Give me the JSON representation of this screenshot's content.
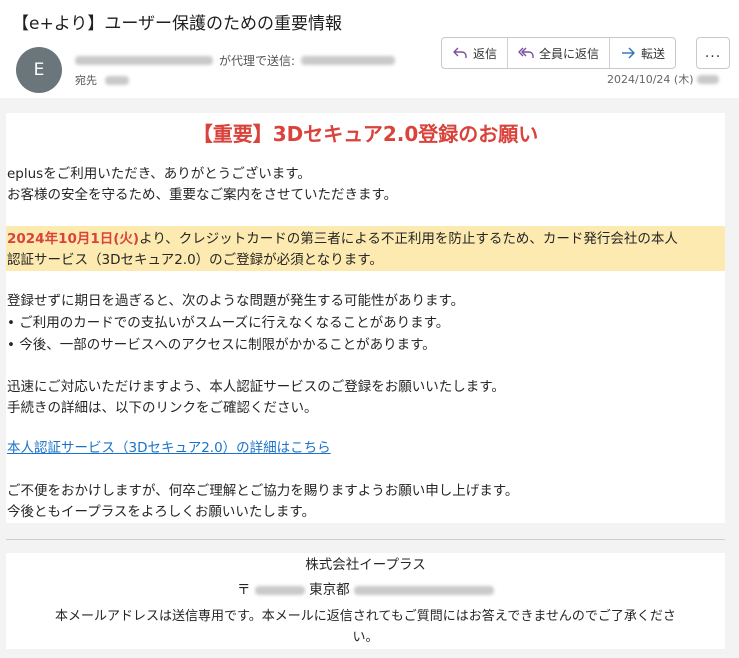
{
  "email": {
    "subject": "【e+より】ユーザー保護のための重要情報",
    "avatar_letter": "E",
    "sender_via": "が代理で送信:",
    "to_label": "宛先",
    "date": "2024/10/24 (木)"
  },
  "actions": {
    "reply": "返信",
    "reply_all": "全員に返信",
    "forward": "転送",
    "more": "..."
  },
  "content": {
    "title": "【重要】3Dセキュア2.0登録のお願い",
    "greeting1": "eplusをご利用いただき、ありがとうございます。",
    "greeting2": "お客様の安全を守るため、重要なご案内をさせていただきます。",
    "notice_date": "2024年10月1日(火)",
    "notice_rest1": "より、クレジットカードの第三者による不正利用を防止するため、カード発行会社の本人",
    "notice_line2": "認証サービス（3Dセキュア2.0）のご登録が必須となります。",
    "warn1": "登録せずに期日を過ぎると、次のような問題が発生する可能性があります。",
    "warn2": "• ご利用のカードでの支払いがスムーズに行えなくなることがあります。",
    "warn3": "• 今後、一部のサービスへのアクセスに制限がかかることがあります。",
    "request1": "迅速にご対応いただけますよう、本人認証サービスのご登録をお願いいたします。",
    "request2": "手続きの詳細は、以下のリンクをご確認ください。",
    "link": "本人認証サービス（3Dセキュア2.0）の詳細はこちら",
    "closing1": "ご不便をおかけしますが、何卒ご理解とご協力を賜りますようお願い申し上げます。",
    "closing2": "今後ともイープラスをよろしくお願いいたします。"
  },
  "footer": {
    "company": "株式会社イープラス",
    "postal_mark": "〒",
    "city": "東京都",
    "notice1": "本メールアドレスは送信専用です。本メールに返信されてもご質問にはお答えできませんのでご了承くださ",
    "notice2": "い。"
  },
  "colors": {
    "accent_red": "#d9433b",
    "highlight_bg": "#fdeab0",
    "link_blue": "#1a73c9",
    "avatar_bg": "#6b767c",
    "icon_purple": "#7b4fa0",
    "icon_blue": "#2a6ebd"
  },
  "icons": {
    "reply": "reply-arrow-icon",
    "reply_all": "reply-all-arrow-icon",
    "forward": "forward-arrow-icon",
    "more": "ellipsis-icon"
  }
}
